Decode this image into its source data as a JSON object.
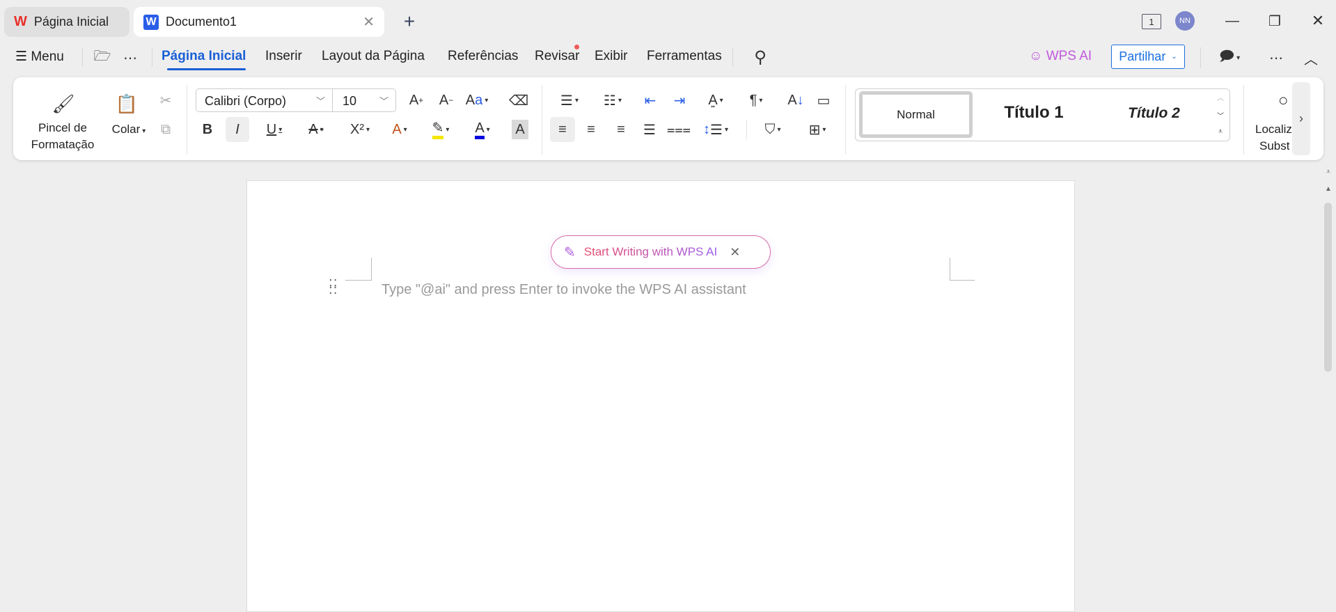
{
  "tabs": [
    {
      "label": "Página Inicial",
      "icon": "wps-logo-icon",
      "active": false
    },
    {
      "label": "Documento1",
      "icon": "writer-doc-icon",
      "active": true
    }
  ],
  "window": {
    "avatar": "NN",
    "page_count": "1"
  },
  "menu": {
    "menu_label": "Menu",
    "items": [
      "Página Inicial",
      "Inserir",
      "Layout da Página",
      "Referências",
      "Revisar",
      "Exibir",
      "Ferramentas"
    ],
    "active": "Página Inicial",
    "wps_ai": "WPS AI",
    "share": "Partilhar"
  },
  "ribbon": {
    "format_painter": [
      "Pincel de",
      "Formatação"
    ],
    "paste": "Colar",
    "font_name": "Calibri (Corpo)",
    "font_size": "10",
    "styles": [
      "Normal",
      "Título 1",
      "Título 2"
    ],
    "find": [
      "Localiz",
      "Subst"
    ]
  },
  "colors": {
    "accent": "#1a5fd6",
    "highlight": "#f5e600",
    "font_color": "#0000e0",
    "revisar_dot": "#f05a5a"
  },
  "document": {
    "ai_pill": "Start Writing with WPS AI",
    "placeholder": "Type \"@ai\" and press Enter to invoke the WPS AI assistant"
  }
}
